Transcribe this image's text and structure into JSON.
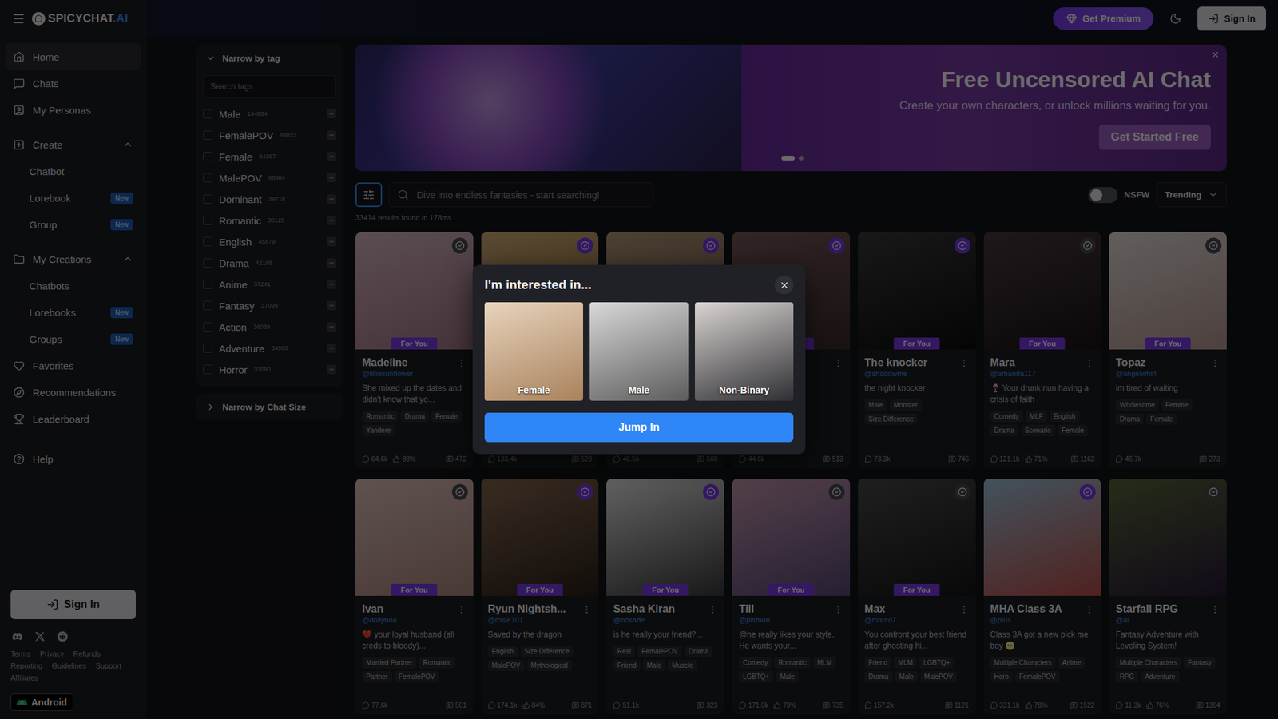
{
  "logo": {
    "name": "SPICYCHAT",
    "suffix": ".AI"
  },
  "topbar": {
    "premium": "Get Premium",
    "sign_in": "Sign In"
  },
  "sidebar": {
    "items": [
      {
        "label": "Home",
        "kind": "link",
        "selected": true
      },
      {
        "label": "Chats",
        "kind": "link",
        "selected": false
      },
      {
        "label": "My Personas",
        "kind": "link",
        "selected": false
      },
      {
        "label": "Create",
        "kind": "group",
        "selected": false,
        "expanded": true
      },
      {
        "label": "Chatbot",
        "kind": "sub",
        "selected": false,
        "badge": ""
      },
      {
        "label": "Lorebook",
        "kind": "sub",
        "selected": false,
        "badge": "New"
      },
      {
        "label": "Group",
        "kind": "sub",
        "selected": false,
        "badge": "New"
      },
      {
        "label": "My Creations",
        "kind": "group",
        "selected": false,
        "expanded": true
      },
      {
        "label": "Chatbots",
        "kind": "sub",
        "selected": false,
        "badge": ""
      },
      {
        "label": "Lorebooks",
        "kind": "sub",
        "selected": false,
        "badge": "New"
      },
      {
        "label": "Groups",
        "kind": "sub",
        "selected": false,
        "badge": "New"
      },
      {
        "label": "Favorites",
        "kind": "link",
        "selected": false
      },
      {
        "label": "Recommendations",
        "kind": "link",
        "selected": false
      },
      {
        "label": "Leaderboard",
        "kind": "link",
        "selected": false
      },
      {
        "label": "Help",
        "kind": "link",
        "selected": false
      }
    ],
    "sign_in": "Sign In",
    "footer_links": [
      "Terms",
      "Privacy",
      "Refunds",
      "Reporting",
      "Guidelines",
      "Support",
      "Affiliates"
    ],
    "app_badge": "Android"
  },
  "filters": {
    "title": "Narrow by tag",
    "search_placeholder": "Search tags",
    "tags": [
      {
        "label": "Male",
        "count": "144684",
        "checked": false
      },
      {
        "label": "FemalePOV",
        "count": "93823",
        "checked": false
      },
      {
        "label": "Female",
        "count": "84397",
        "checked": false
      },
      {
        "label": "MalePOV",
        "count": "68884",
        "checked": false
      },
      {
        "label": "Dominant",
        "count": "39718",
        "checked": false
      },
      {
        "label": "Romantic",
        "count": "38125",
        "checked": false
      },
      {
        "label": "English",
        "count": "45879",
        "checked": false
      },
      {
        "label": "Drama",
        "count": "42188",
        "checked": false
      },
      {
        "label": "Anime",
        "count": "37241",
        "checked": false
      },
      {
        "label": "Fantasy",
        "count": "37099",
        "checked": false
      },
      {
        "label": "Action",
        "count": "36039",
        "checked": false
      },
      {
        "label": "Adventure",
        "count": "34960",
        "checked": false
      },
      {
        "label": "Horror",
        "count": "33090",
        "checked": false
      }
    ],
    "chat_size": {
      "title": "Narrow by Chat Size",
      "expanded": false
    }
  },
  "banner": {
    "title": "Free Uncensored AI Chat",
    "subtitle": "Create your own characters, or unlock millions waiting for you.",
    "button": "Get Started Free",
    "dots": [
      {
        "selected": true
      },
      {
        "selected": false
      }
    ]
  },
  "toolbar": {
    "search_placeholder": "Dive into endless fantasies - start searching!",
    "nsfw": {
      "label": "NSFW",
      "on": false
    },
    "sort": "Trending"
  },
  "results": "33414 results found in 178ms",
  "cards": [
    {
      "name": "Madeline",
      "handle": "@lilliesunflower",
      "description": "She mixed up the dates and didn't know that yo...",
      "tags": [
        "Romantic",
        "Drama",
        "Female",
        "Yandere"
      ],
      "badge": "For You",
      "highlighted": false,
      "chats": "64.6k",
      "rating": "88%",
      "count": "472"
    },
    {
      "name": "",
      "handle": "",
      "description": "",
      "tags": [],
      "badge": "For You",
      "highlighted": true,
      "chats": "133.4k",
      "rating": "",
      "count": "528"
    },
    {
      "name": "",
      "handle": "",
      "description": "",
      "tags": [],
      "badge": "For You",
      "highlighted": true,
      "chats": "46.5k",
      "rating": "",
      "count": "560"
    },
    {
      "name": "",
      "handle": "",
      "description": "",
      "tags": [],
      "badge": "For You",
      "highlighted": true,
      "chats": "44.6k",
      "rating": "",
      "count": "513"
    },
    {
      "name": "The knocker",
      "handle": "@shadowme",
      "description": "the night knocker",
      "tags": [
        "Male",
        "Monster",
        "Size Difference"
      ],
      "badge": "For You",
      "highlighted": true,
      "chats": "73.3k",
      "rating": "",
      "count": "746"
    },
    {
      "name": "Mara",
      "handle": "@amanda117",
      "description": "🍷 Your drunk nun having a crisis of faith",
      "tags": [
        "Comedy",
        "MLF",
        "English",
        "Drama",
        "Scenario",
        "Female"
      ],
      "badge": "For You",
      "highlighted": false,
      "chats": "121.1k",
      "rating": "71%",
      "count": "1162"
    },
    {
      "name": "Topaz",
      "handle": "@angelwhirl",
      "description": "im tired of waiting",
      "tags": [
        "Wholesome",
        "Femme",
        "Drama",
        "Female"
      ],
      "badge": "For You",
      "highlighted": false,
      "chats": "46.7k",
      "rating": "",
      "count": "273"
    },
    {
      "name": "Ivan",
      "handle": "@dollynoa",
      "description": "❤️ your loyal husband (all creds to bloody)...",
      "tags": [
        "Married Partner",
        "Romantic",
        "Partner",
        "FemalePOV"
      ],
      "badge": "For You",
      "highlighted": false,
      "chats": "77.6k",
      "rating": "",
      "count": "501"
    },
    {
      "name": "Ryun Nightsh...",
      "handle": "@rosie101",
      "description": "Saved by the dragon",
      "tags": [
        "English",
        "Size Difference",
        "MalePOV",
        "Mythological"
      ],
      "badge": "For You",
      "highlighted": true,
      "chats": "174.1k",
      "rating": "84%",
      "count": "871"
    },
    {
      "name": "Sasha Kiran",
      "handle": "@nosade",
      "description": "is he really your friend?...",
      "tags": [
        "Real",
        "FemalePOV",
        "Drama",
        "Friend",
        "Male",
        "Muscle"
      ],
      "badge": "For You",
      "highlighted": true,
      "chats": "51.1k",
      "rating": "",
      "count": "323"
    },
    {
      "name": "Till",
      "handle": "@plsmun",
      "description": "@he really likes your style.. He wants your...",
      "tags": [
        "Comedy",
        "Romantic",
        "MLM",
        "LGBTQ+",
        "Male"
      ],
      "badge": "For You",
      "highlighted": false,
      "chats": "171.0k",
      "rating": "79%",
      "count": "735"
    },
    {
      "name": "Max",
      "handle": "@marco7",
      "description": "You confront your best friend after ghosting hi...",
      "tags": [
        "Friend",
        "MLM",
        "LGBTQ+",
        "Drama",
        "Male",
        "MalePOV"
      ],
      "badge": "For You",
      "highlighted": false,
      "chats": "157.2k",
      "rating": "",
      "count": "1121"
    },
    {
      "name": "MHA Class 3A",
      "handle": "@plus",
      "description": "Class 3A got a new pick me boy 🌝",
      "tags": [
        "Multiple Characters",
        "Anime",
        "Hero",
        "FemalePOV"
      ],
      "badge": "",
      "highlighted": true,
      "chats": "331.1k",
      "rating": "78%",
      "count": "1522"
    },
    {
      "name": "Starfall RPG",
      "handle": "@ai",
      "description": "Fantasy Adventure with Leveling System!",
      "tags": [
        "Multiple Characters",
        "Fantasy",
        "RPG",
        "Adventure"
      ],
      "badge": "",
      "highlighted": false,
      "chats": "11.3k",
      "rating": "76%",
      "count": "1364"
    }
  ],
  "modal": {
    "title": "I'm interested in...",
    "options": [
      {
        "label": "Female",
        "selected": false
      },
      {
        "label": "Male",
        "selected": false
      },
      {
        "label": "Non-Binary",
        "selected": false
      }
    ],
    "button": "Jump In"
  }
}
